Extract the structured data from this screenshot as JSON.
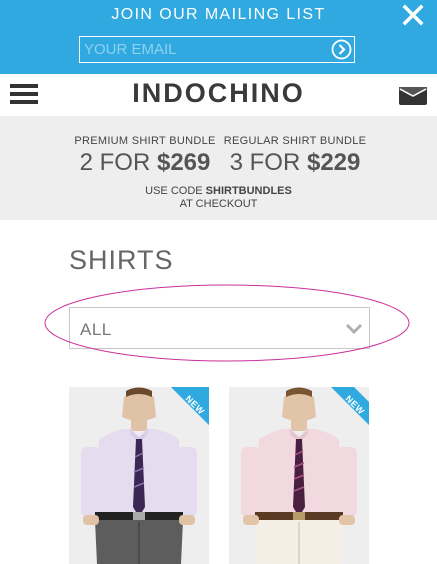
{
  "mailing_bar": {
    "title": "JOIN OUR MAILING LIST",
    "email_placeholder": "YOUR EMAIL",
    "close_icon": "close-icon",
    "submit_icon": "arrow-circle-right-icon",
    "background_color": "#2fa9e0"
  },
  "header": {
    "logo": "INDOCHINO",
    "menu_icon": "hamburger-menu-icon",
    "cart_icon": "cart-icon"
  },
  "promo": {
    "bundles": [
      {
        "label": "PREMIUM SHIRT BUNDLE",
        "qty": "2 FOR ",
        "price": "$269"
      },
      {
        "label": "REGULAR SHIRT BUNDLE",
        "qty": "3 FOR ",
        "price": "$229"
      }
    ],
    "code_prefix": "USE CODE ",
    "code": "SHIRTBUNDLES",
    "code_suffix": "AT CHECKOUT"
  },
  "shirts": {
    "title": "SHIRTS",
    "filter_value": "ALL",
    "annotation_color": "#cc2f9a",
    "products": [
      {
        "badge": "NEW",
        "shirt_color": "#e6dcf0",
        "tie_color": "#3b2654",
        "pants_color": "#5d5d5d"
      },
      {
        "badge": "NEW",
        "shirt_color": "#f2d8df",
        "tie_color": "#4a1f3f",
        "pants_color": "#f3efe4"
      }
    ]
  }
}
